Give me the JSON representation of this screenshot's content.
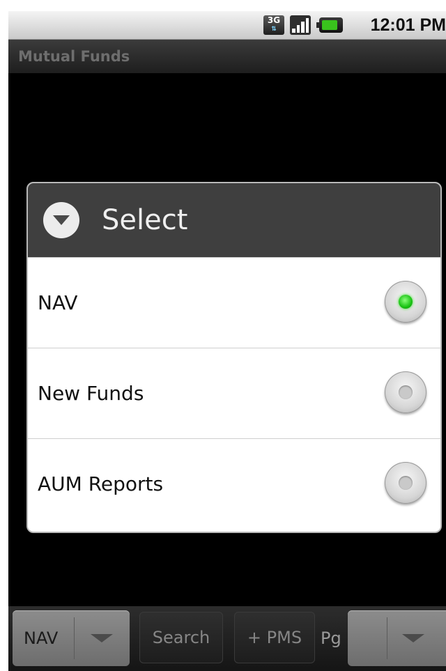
{
  "status_bar": {
    "network_label": "3G",
    "network_icon": "3g-data-icon",
    "signal_icon": "signal-strength-icon",
    "battery_icon": "battery-charging-icon",
    "time": "12:01 PM"
  },
  "app": {
    "title": "Mutual Funds"
  },
  "dialog": {
    "title": "Select",
    "icon": "dropdown-circle-icon",
    "options": [
      {
        "label": "NAV",
        "selected": true
      },
      {
        "label": "New Funds",
        "selected": false
      },
      {
        "label": "AUM Reports",
        "selected": false
      }
    ]
  },
  "bottom_bar": {
    "category_spinner_value": "NAV",
    "search_label": "Search",
    "pms_label": "+ PMS",
    "pg_label": "Pg",
    "page_spinner_value": ""
  },
  "colors": {
    "selected_radio": "#18c212",
    "dialog_header": "#3f3f3f",
    "background": "#000000"
  }
}
